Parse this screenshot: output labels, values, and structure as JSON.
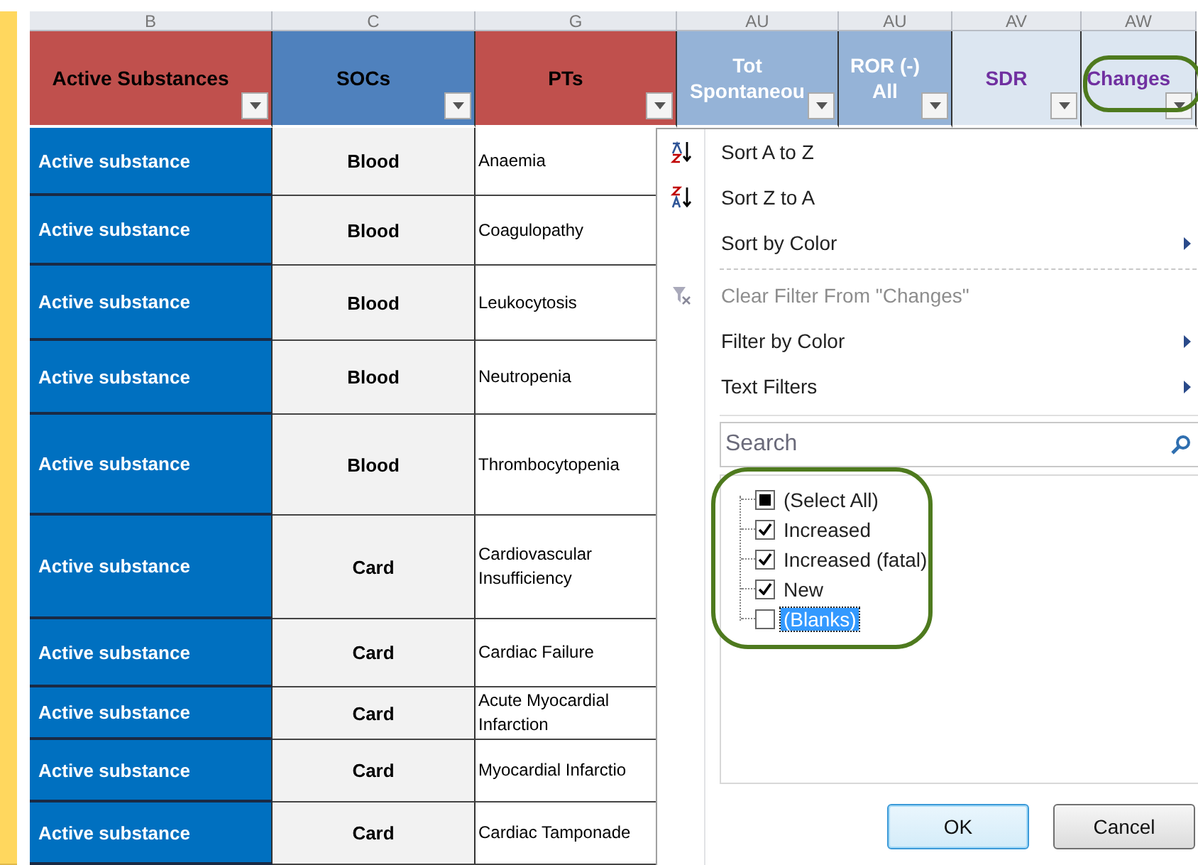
{
  "columns": [
    {
      "letter": "B",
      "header": "Active Substances",
      "color": "#c0504d",
      "kind": "dark"
    },
    {
      "letter": "C",
      "header": "SOCs",
      "color": "#4f81bd",
      "kind": "dark"
    },
    {
      "letter": "G",
      "header": "PTs",
      "color": "#c0504d",
      "kind": "dark"
    },
    {
      "letter": "AU",
      "header": "Tot Spontaneou",
      "color": "#95b3d7",
      "kind": "light"
    },
    {
      "letter": "AU",
      "header": "ROR (-) All",
      "color": "#95b3d7",
      "kind": "light"
    },
    {
      "letter": "AV",
      "header": "SDR",
      "color": "#dce6f1",
      "kind": "purple"
    },
    {
      "letter": "AW",
      "header": "Changes",
      "color": "#dce6f1",
      "kind": "purple"
    }
  ],
  "rows": [
    {
      "substance": "Active substance",
      "soc": "Blood",
      "pt": "Anaemia"
    },
    {
      "substance": "Active substance",
      "soc": "Blood",
      "pt": "Coagulopathy"
    },
    {
      "substance": "Active substance",
      "soc": "Blood",
      "pt": "Leukocytosis"
    },
    {
      "substance": "Active substance",
      "soc": "Blood",
      "pt": "Neutropenia"
    },
    {
      "substance": "Active substance",
      "soc": "Blood",
      "pt": "Thrombocytopenia"
    },
    {
      "substance": "Active substance",
      "soc": "Card",
      "pt": "Cardiovascular Insufficiency"
    },
    {
      "substance": "Active substance",
      "soc": "Card",
      "pt": "Cardiac Failure"
    },
    {
      "substance": "Active substance",
      "soc": "Card",
      "pt": "Acute Myocardial Infarction"
    },
    {
      "substance": "Active substance",
      "soc": "Card",
      "pt": "Myocardial Infarctio"
    },
    {
      "substance": "Active substance",
      "soc": "Card",
      "pt": "Cardiac Tamponade"
    }
  ],
  "filter_menu": {
    "items": [
      {
        "label": "Sort A to Z",
        "kind": "sort_az",
        "disabled": false,
        "submenu": false
      },
      {
        "label": "Sort Z to A",
        "kind": "sort_za",
        "disabled": false,
        "submenu": false
      },
      {
        "label": "Sort by Color",
        "kind": "plain",
        "disabled": false,
        "submenu": true
      },
      {
        "label": "Clear Filter From \"Changes\"",
        "kind": "clear",
        "disabled": true,
        "submenu": false
      },
      {
        "label": "Filter by Color",
        "kind": "plain",
        "disabled": false,
        "submenu": true
      },
      {
        "label": "Text Filters",
        "kind": "plain",
        "disabled": false,
        "submenu": true
      }
    ],
    "search": {
      "placeholder": "Search"
    },
    "values": [
      {
        "label": "(Select All)",
        "checked": false,
        "partial": true,
        "selected": false
      },
      {
        "label": "Increased",
        "checked": true,
        "selected": false
      },
      {
        "label": "Increased (fatal)",
        "checked": true,
        "selected": false
      },
      {
        "label": "New",
        "checked": true,
        "selected": false
      },
      {
        "label": "(Blanks)",
        "checked": false,
        "partial": false,
        "selected": true
      }
    ],
    "buttons": [
      {
        "label": "OK",
        "focused": true
      },
      {
        "label": "Cancel",
        "focused": false
      }
    ]
  }
}
